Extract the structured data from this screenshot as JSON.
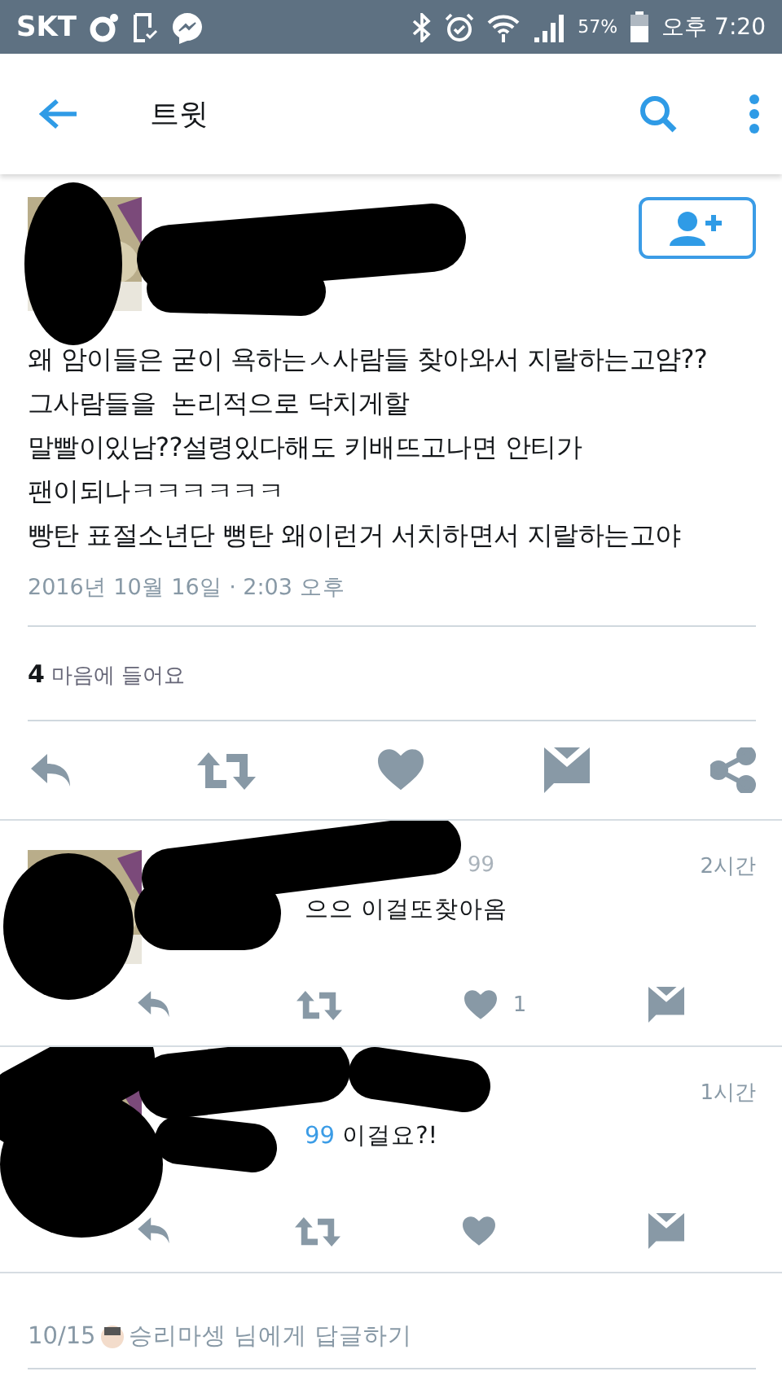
{
  "status_bar": {
    "carrier": "SKT",
    "battery": "57%",
    "time": "오후 7:20"
  },
  "app_bar": {
    "title": "트윗"
  },
  "tweet": {
    "text": "왜 암이들은 굳이 욕하는ㅅ사람들 찾아와서 지랄하는고얌??\n그사람들을  논리적으로 닥치게할\n말빨이있남??설령있다해도 키배뜨고나면 안티가\n팬이되나ㅋㅋㅋㅋㅋㅋ\n빵탄 표절소년단 뻥탄 왜이런거 서치하면서 지랄하는고야",
    "timestamp": "2016년 10월 16일 · 2:03 오후",
    "like_count": "4",
    "like_label": "마음에 들어요"
  },
  "replies": [
    {
      "handle_fragment": "99",
      "time": "2시간",
      "text": "으으 이걸또찾아옴",
      "like_count": "1"
    },
    {
      "time": "1시간",
      "mention_fragment": "99",
      "text": "이걸요?!"
    }
  ],
  "reply_prompt": {
    "date": "10/15",
    "name": "승리마셍",
    "text": "님에게 답글하기"
  }
}
